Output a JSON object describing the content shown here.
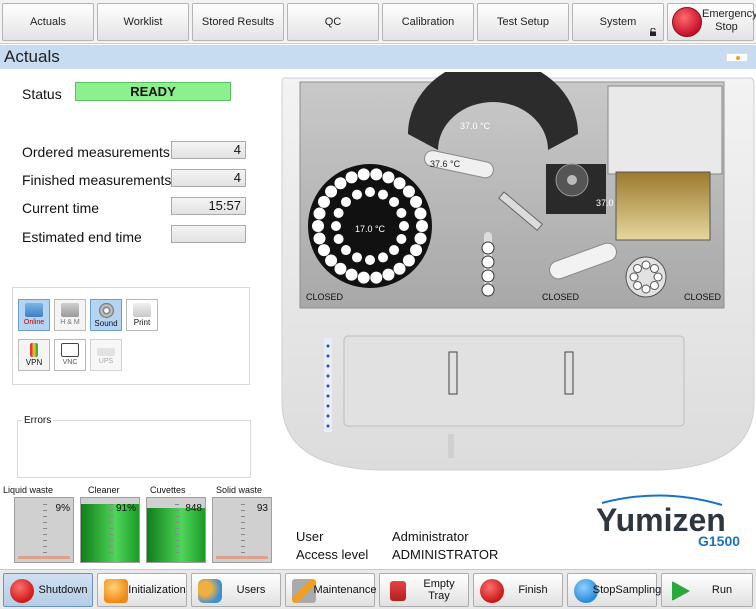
{
  "nav": {
    "actuals": "Actuals",
    "worklist": "Worklist",
    "stored_results": "Stored Results",
    "qc": "QC",
    "calibration": "Calibration",
    "test_setup": "Test Setup",
    "system": "System",
    "emergency_stop_line1": "Emergency",
    "emergency_stop_line2": "Stop"
  },
  "page": {
    "title": "Actuals"
  },
  "status": {
    "label": "Status",
    "value": "READY"
  },
  "measurements": {
    "ordered_label": "Ordered measurements",
    "ordered_value": "4",
    "finished_label": "Finished measurements",
    "finished_value": "4",
    "current_time_label": "Current time",
    "current_time_value": "15:57",
    "estimated_end_label": "Estimated end time",
    "estimated_end_value": ""
  },
  "connectivity": {
    "online": "Online",
    "hm": "H & M",
    "sound": "Sound",
    "print": "Print",
    "vpn": "VPN",
    "vnc": "VNC",
    "ups": "UPS"
  },
  "errors": {
    "label": "Errors"
  },
  "gauges": [
    {
      "label": "Liquid waste",
      "value": "9%",
      "fill_pct": 9
    },
    {
      "label": "Cleaner",
      "value": "91%",
      "fill_pct": 91
    },
    {
      "label": "Cuvettes",
      "value": "848",
      "fill_pct": 85
    },
    {
      "label": "Solid waste",
      "value": "93",
      "fill_pct": 9
    }
  ],
  "instrument": {
    "reagent_arc_temp": "37.0 °C",
    "probe_temp": "37.6 °C",
    "sample_disc_temp": "17.0 °C",
    "rotor_temp": "37.0 °C",
    "closed_left": "CLOSED",
    "closed_middle": "CLOSED",
    "closed_right": "CLOSED"
  },
  "user": {
    "user_label": "User",
    "user_value": "Administrator",
    "access_label": "Access level",
    "access_value": "ADMINISTRATOR"
  },
  "brand": {
    "name": "Yumizen",
    "model": "G1500"
  },
  "toolbar": {
    "shutdown": "Shutdown",
    "initialization": "Initialization",
    "users": "Users",
    "maintenance": "Maintenance",
    "empty_tray": "Empty Tray",
    "finish": "Finish",
    "stop_sampling_line1": "Stop",
    "stop_sampling_line2": "Sampling",
    "run": "Run"
  },
  "colors": {
    "status_ready": "#8df08f",
    "title_bar": "#c7dcf0",
    "gauge_green": "#2fb53b",
    "brand_blue": "#1a73c6",
    "emergency_red": "#c8102e"
  }
}
